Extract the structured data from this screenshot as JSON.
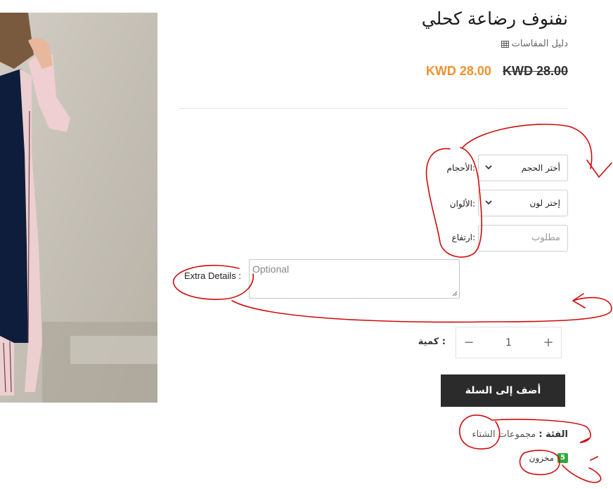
{
  "product": {
    "title": "نفنوف رضاعة كحلي",
    "size_guide": "دليل المقاسات",
    "price_old": "KWD 28.00",
    "price_new": "KWD 28.00",
    "price_new_color": "#f0922e"
  },
  "options": {
    "sizes_label": ":الأحجام",
    "sizes_value": "أختر الحجم",
    "colors_label": ":الألوان",
    "colors_value": "إختر لون",
    "height_label": ":ارتفاع",
    "height_placeholder": "مطلوب"
  },
  "extra": {
    "label": "Extra Details :",
    "placeholder": "Optional"
  },
  "quantity": {
    "label": ": كمية",
    "value": "1",
    "minus": "−",
    "plus": "+"
  },
  "cart": {
    "add_label": "أضف إلى السلة"
  },
  "meta": {
    "category_label": "الفئة :",
    "category_value": "مجموعات الشتاء",
    "stock_count": "5",
    "stock_label": "مخزون",
    "stock_color": "#2eaa3b"
  },
  "annotation_color": "#d10a0a",
  "icons": [
    "grid-icon",
    "chevron-down-icon",
    "minus-icon",
    "plus-icon",
    "resize-grip-icon"
  ]
}
